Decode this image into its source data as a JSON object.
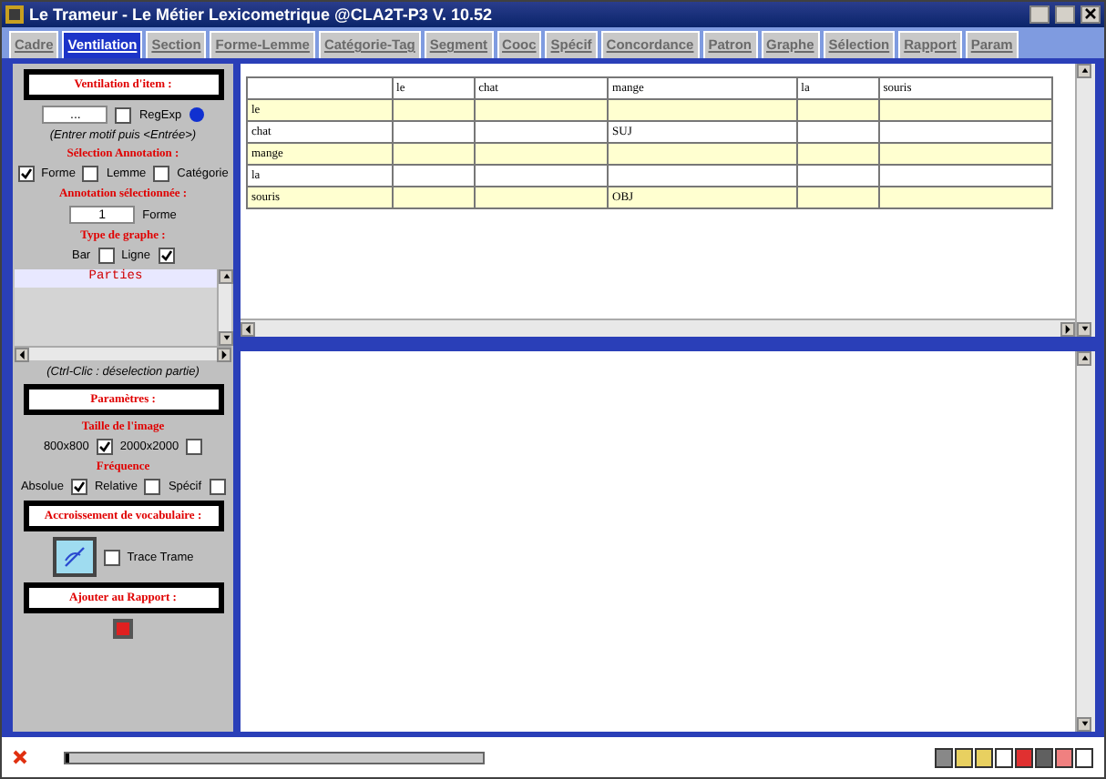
{
  "window": {
    "title": "Le Trameur - Le Métier Lexicometrique @CLA2T-P3 V. 10.52"
  },
  "tabs": [
    {
      "label": "Cadre",
      "selected": false
    },
    {
      "label": "Ventilation",
      "selected": true
    },
    {
      "label": "Section",
      "selected": false
    },
    {
      "label": "Forme-Lemme",
      "selected": false
    },
    {
      "label": "Catégorie-Tag",
      "selected": false
    },
    {
      "label": "Segment",
      "selected": false
    },
    {
      "label": "Cooc",
      "selected": false
    },
    {
      "label": "Spécif",
      "selected": false
    },
    {
      "label": "Concordance",
      "selected": false
    },
    {
      "label": "Patron",
      "selected": false
    },
    {
      "label": "Graphe",
      "selected": false
    },
    {
      "label": "Sélection",
      "selected": false
    },
    {
      "label": "Rapport",
      "selected": false
    },
    {
      "label": "Param",
      "selected": false
    }
  ],
  "left_panel": {
    "item_heading": "Ventilation d'item :",
    "pattern_field": {
      "value": "..."
    },
    "regexp": {
      "label": "RegExp",
      "checked": false
    },
    "hint": "(Entrer motif puis <Entrée>)",
    "annotation_heading": "Sélection Annotation :",
    "annotations": [
      {
        "label": "Forme",
        "checked": true
      },
      {
        "label": "Lemme",
        "checked": false
      },
      {
        "label": "Catégorie",
        "checked": false
      }
    ],
    "selected_heading": "Annotation sélectionnée :",
    "selected_number": "1",
    "selected_label": "Forme",
    "graph_heading": "Type de graphe :",
    "graph_types": [
      {
        "label": "Bar",
        "checked": false
      },
      {
        "label": "Ligne",
        "checked": true
      }
    ],
    "parts_list": {
      "header": "Parties"
    },
    "parts_hint": "(Ctrl-Clic : déselection partie)",
    "params_heading": "Paramètres :",
    "size_heading": "Taille de l'image",
    "sizes": [
      {
        "label": "800x800",
        "checked": true
      },
      {
        "label": "2000x2000",
        "checked": false
      }
    ],
    "freq_heading": "Fréquence",
    "frequencies": [
      {
        "label": "Absolue",
        "checked": true
      },
      {
        "label": "Relative",
        "checked": false
      },
      {
        "label": "Spécif",
        "checked": false
      }
    ],
    "growth_heading": "Accroissement de vocabulaire :",
    "trace": {
      "label": "Trace Trame",
      "checked": false
    },
    "report_heading": "Ajouter au Rapport :"
  },
  "table": {
    "columns": [
      "le",
      "chat",
      "mange",
      "la",
      "souris"
    ],
    "rows": [
      {
        "label": "le",
        "cells": [
          "",
          "",
          "",
          "",
          ""
        ]
      },
      {
        "label": "chat",
        "cells": [
          "",
          "",
          "SUJ",
          "",
          ""
        ]
      },
      {
        "label": "mange",
        "cells": [
          "",
          "",
          "",
          "",
          ""
        ]
      },
      {
        "label": "la",
        "cells": [
          "",
          "",
          "",
          "",
          ""
        ]
      },
      {
        "label": "souris",
        "cells": [
          "",
          "",
          "OBJ",
          "",
          ""
        ]
      }
    ]
  },
  "status_bar": {
    "progress": {
      "level": 0
    }
  }
}
